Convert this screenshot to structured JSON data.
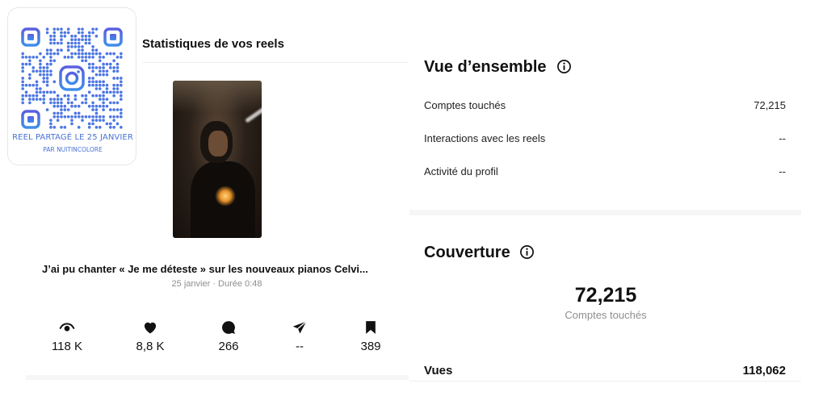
{
  "qr_card": {
    "caption_line1": "REEL PARTAGÉ LE 25 JANVIER",
    "caption_line2": "PAR NUITINCOLORE",
    "center_icon": "instagram-logo",
    "colors": {
      "top": "#5b5fe0",
      "bottom": "#3f8ee8"
    }
  },
  "left_panel": {
    "title": "Statistiques de vos reels",
    "reel": {
      "caption": "J’ai pu chanter « Je me déteste » sur les nouveaux pianos Celvi...",
      "meta": "25 janvier · Durée 0:48"
    },
    "stats": [
      {
        "icon": "eye-icon",
        "value": "118 K"
      },
      {
        "icon": "heart-icon",
        "value": "8,8 K"
      },
      {
        "icon": "comment-icon",
        "value": "266"
      },
      {
        "icon": "share-icon",
        "value": "--"
      },
      {
        "icon": "bookmark-icon",
        "value": "389"
      }
    ]
  },
  "overview": {
    "title": "Vue d’ensemble",
    "rows": [
      {
        "label": "Comptes touchés",
        "value": "72,215"
      },
      {
        "label": "Interactions avec les reels",
        "value": "--"
      },
      {
        "label": "Activité du profil",
        "value": "--"
      }
    ]
  },
  "coverage": {
    "title": "Couverture",
    "big_number": "72,215",
    "big_label": "Comptes touchés",
    "views_label": "Vues",
    "views_value": "118,062"
  }
}
